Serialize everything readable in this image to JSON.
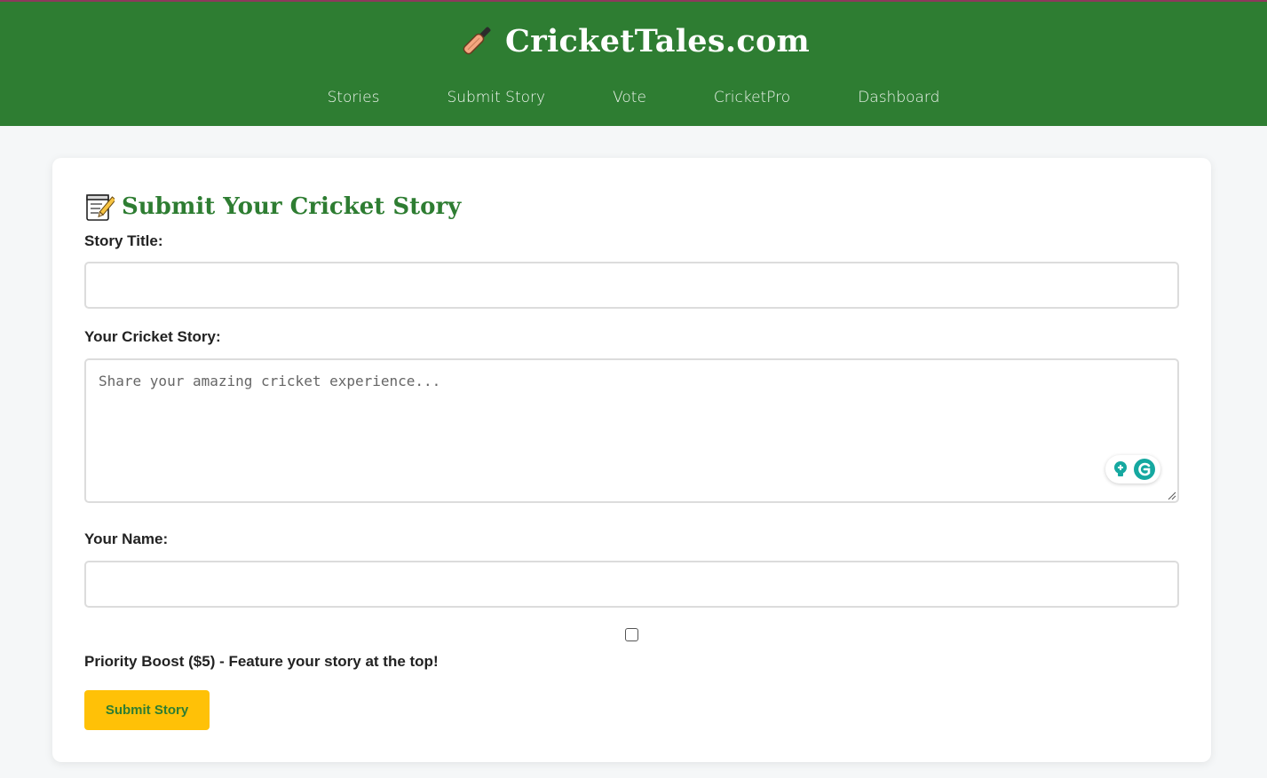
{
  "header": {
    "site_name": "CricketTales.com",
    "logo_icon": "cricket-bat-icon",
    "nav": [
      {
        "label": "Stories"
      },
      {
        "label": "Submit Story"
      },
      {
        "label": "Vote"
      },
      {
        "label": "CricketPro"
      },
      {
        "label": "Dashboard"
      }
    ]
  },
  "form": {
    "title": "Submit Your Cricket Story",
    "title_icon": "memo-icon",
    "story_title_label": "Story Title:",
    "story_title_value": "",
    "story_label": "Your Cricket Story:",
    "story_placeholder": "Share your amazing cricket experience...",
    "name_label": "Your Name:",
    "name_value": "",
    "boost_checked": false,
    "boost_label": "Priority Boost ($5) - Feature your story at the top!",
    "submit_label": "Submit Story"
  },
  "colors": {
    "brand_green": "#2e7d32",
    "accent_yellow": "#ffc107",
    "page_bg": "#f5f7f8"
  }
}
